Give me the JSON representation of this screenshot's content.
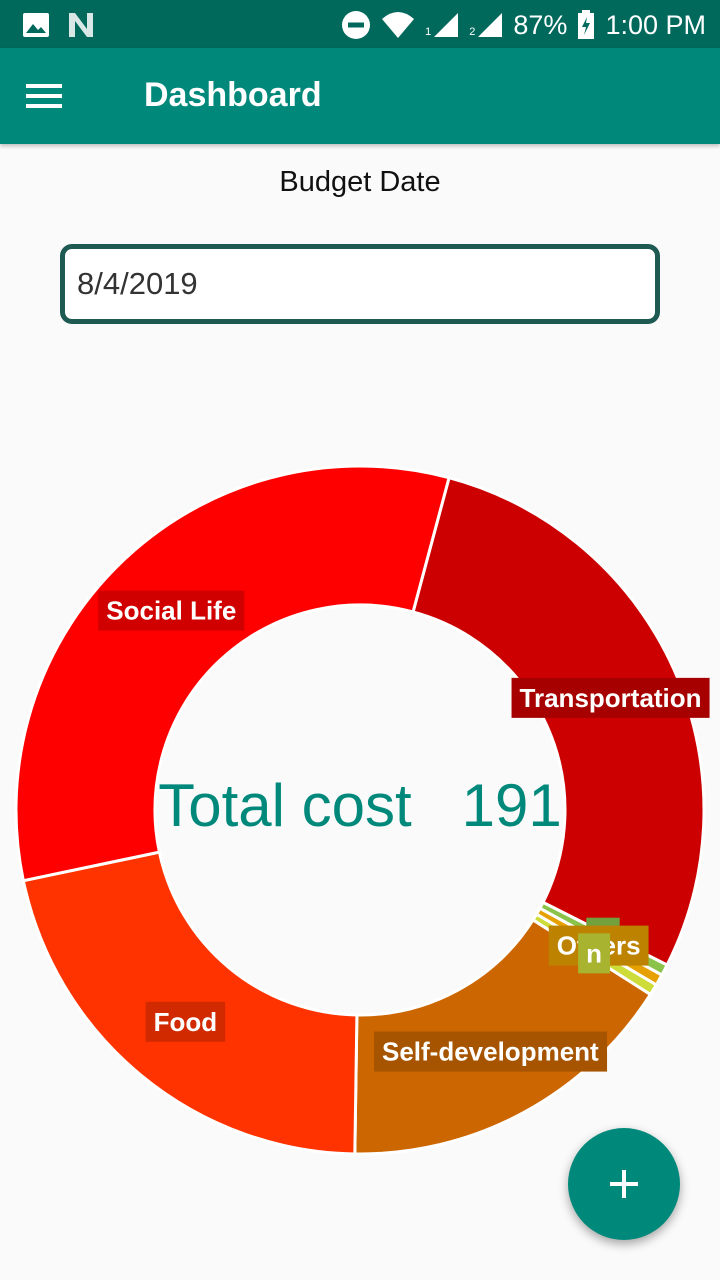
{
  "status_bar": {
    "battery": "87%",
    "time": "1:00 PM",
    "sim1": "1",
    "sim2": "2",
    "icons": [
      "image-icon",
      "n-icon",
      "dnd-icon",
      "wifi-icon",
      "signal-icon",
      "signal-icon",
      "battery-charging-icon"
    ]
  },
  "app_bar": {
    "title": "Dashboard",
    "menu_icon": "menu-icon"
  },
  "form": {
    "budget_label": "Budget Date",
    "date_value": "8/4/2019"
  },
  "chart_data": {
    "type": "pie",
    "center_text": "Total cost   191",
    "slices": [
      {
        "label": "Transportation",
        "value": 54,
        "color": "#cc0000"
      },
      {
        "label": "E",
        "value": 1,
        "color": "#8bc34a"
      },
      {
        "label": "Others",
        "value": 1,
        "color": "#e6a000"
      },
      {
        "label": "n",
        "value": 1,
        "color": "#cddc39"
      },
      {
        "label": "Self-development",
        "value": 31,
        "color": "#cc6600"
      },
      {
        "label": "Food",
        "value": 41,
        "color": "#ff3300"
      },
      {
        "label": "Social Life",
        "value": 62,
        "color": "#ff0000"
      }
    ]
  },
  "fab": {
    "icon": "plus-icon"
  },
  "colors": {
    "status_bar": "#00695c",
    "app_bar": "#00897b",
    "accent": "#00897b",
    "input_border": "#1e5a52"
  }
}
